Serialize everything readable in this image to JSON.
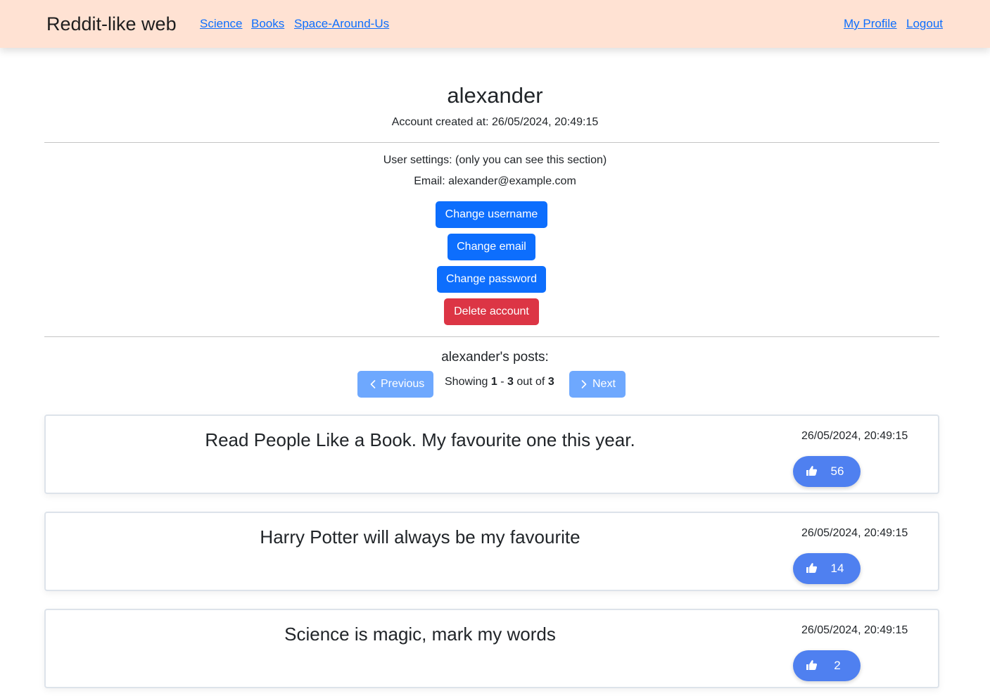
{
  "navbar": {
    "brand": "Reddit-like web",
    "links": [
      "Science",
      "Books",
      "Space-Around-Us"
    ],
    "profile_label": "My Profile",
    "logout_label": "Logout"
  },
  "profile": {
    "username": "alexander",
    "created": "Account created at: 26/05/2024, 20:49:15"
  },
  "settings": {
    "title": "User settings: (only you can see this section)",
    "email": "Email: alexander@example.com",
    "change_username": "Change username",
    "change_email": "Change email",
    "change_password": "Change password",
    "delete_account": "Delete account"
  },
  "posts_section": {
    "title": "alexander's posts:",
    "previous_label": "Previous",
    "next_label": "Next",
    "showing_label": "Showing",
    "range_start": "1",
    "range_sep": "-",
    "range_end": "3",
    "out_of_label": "out of",
    "total": "3"
  },
  "posts": [
    {
      "title": "Read People Like a Book. My favourite one this year.",
      "date": "26/05/2024, 20:49:15",
      "likes": "56"
    },
    {
      "title": "Harry Potter will always be my favourite",
      "date": "26/05/2024, 20:49:15",
      "likes": "14"
    },
    {
      "title": "Science is magic, mark my words",
      "date": "26/05/2024, 20:49:15",
      "likes": "2"
    }
  ],
  "colors": {
    "navbar_bg": "#ffe2d3",
    "primary": "#0d6efd",
    "danger": "#dc3545",
    "pager_disabled": "#6ea8fe",
    "like_pill": "#4f80f0"
  },
  "icons": {
    "previous": "chevron-left-icon",
    "next": "chevron-right-icon",
    "like": "thumbs-up-icon"
  }
}
